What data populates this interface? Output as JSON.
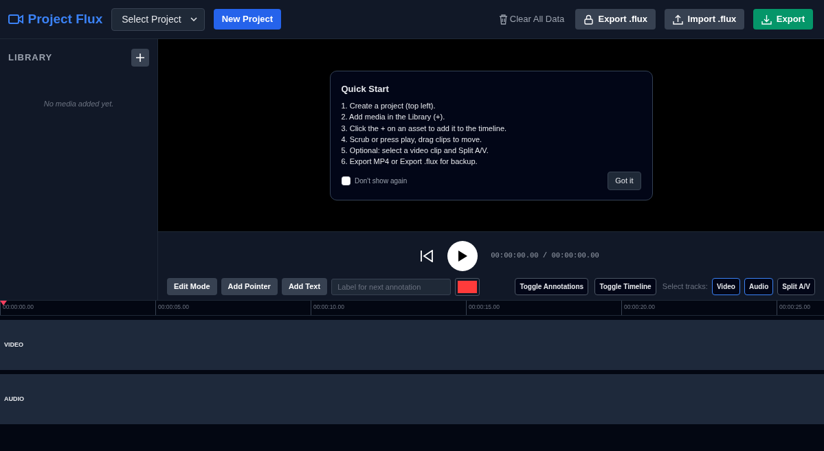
{
  "header": {
    "title": "Project Flux",
    "project_select": "Select Project",
    "new_project": "New Project",
    "clear": "Clear All Data",
    "buttons": [
      {
        "label": "Export .flux",
        "kind": "lock"
      },
      {
        "label": "Import .flux",
        "kind": "upload"
      },
      {
        "label": "Export",
        "kind": "download"
      }
    ]
  },
  "library": {
    "title": "LIBRARY",
    "empty": "No media added yet."
  },
  "quick_start": {
    "title": "Quick Start",
    "steps": [
      "1. Create a project (top left).",
      "2. Add media in the Library (+).",
      "3. Click the + on an asset to add it to the timeline.",
      "4. Scrub or press play, drag clips to move.",
      "5. Optional: select a video clip and Split A/V.",
      "6. Export MP4 or Export .flux for backup."
    ],
    "dont_show": {
      "label": "Don't show again",
      "checked": false
    },
    "button": "Got it"
  },
  "player": {
    "time": "00:00:00.00 / 00:00:00.00"
  },
  "toolbar": {
    "buttons": [
      "Edit Mode",
      "Add Pointer",
      "Add Text"
    ],
    "label_placeholder": "Label for next annotation",
    "color": "#ff3b3b",
    "toggles": [
      "Toggle Annotations",
      "Toggle Timeline"
    ],
    "select_label": "Select tracks:",
    "tracks": [
      {
        "label": "Video",
        "selected": true
      },
      {
        "label": "Audio",
        "selected": true
      },
      {
        "label": "Split A/V",
        "selected": false
      }
    ]
  },
  "timeline": {
    "ticks": [
      "00:00:00.00",
      "00:00:05.00",
      "00:00:10.00",
      "00:00:15.00",
      "00:00:20.00",
      "00:00:25.00"
    ],
    "tracks": [
      "VIDEO",
      "AUDIO"
    ]
  }
}
